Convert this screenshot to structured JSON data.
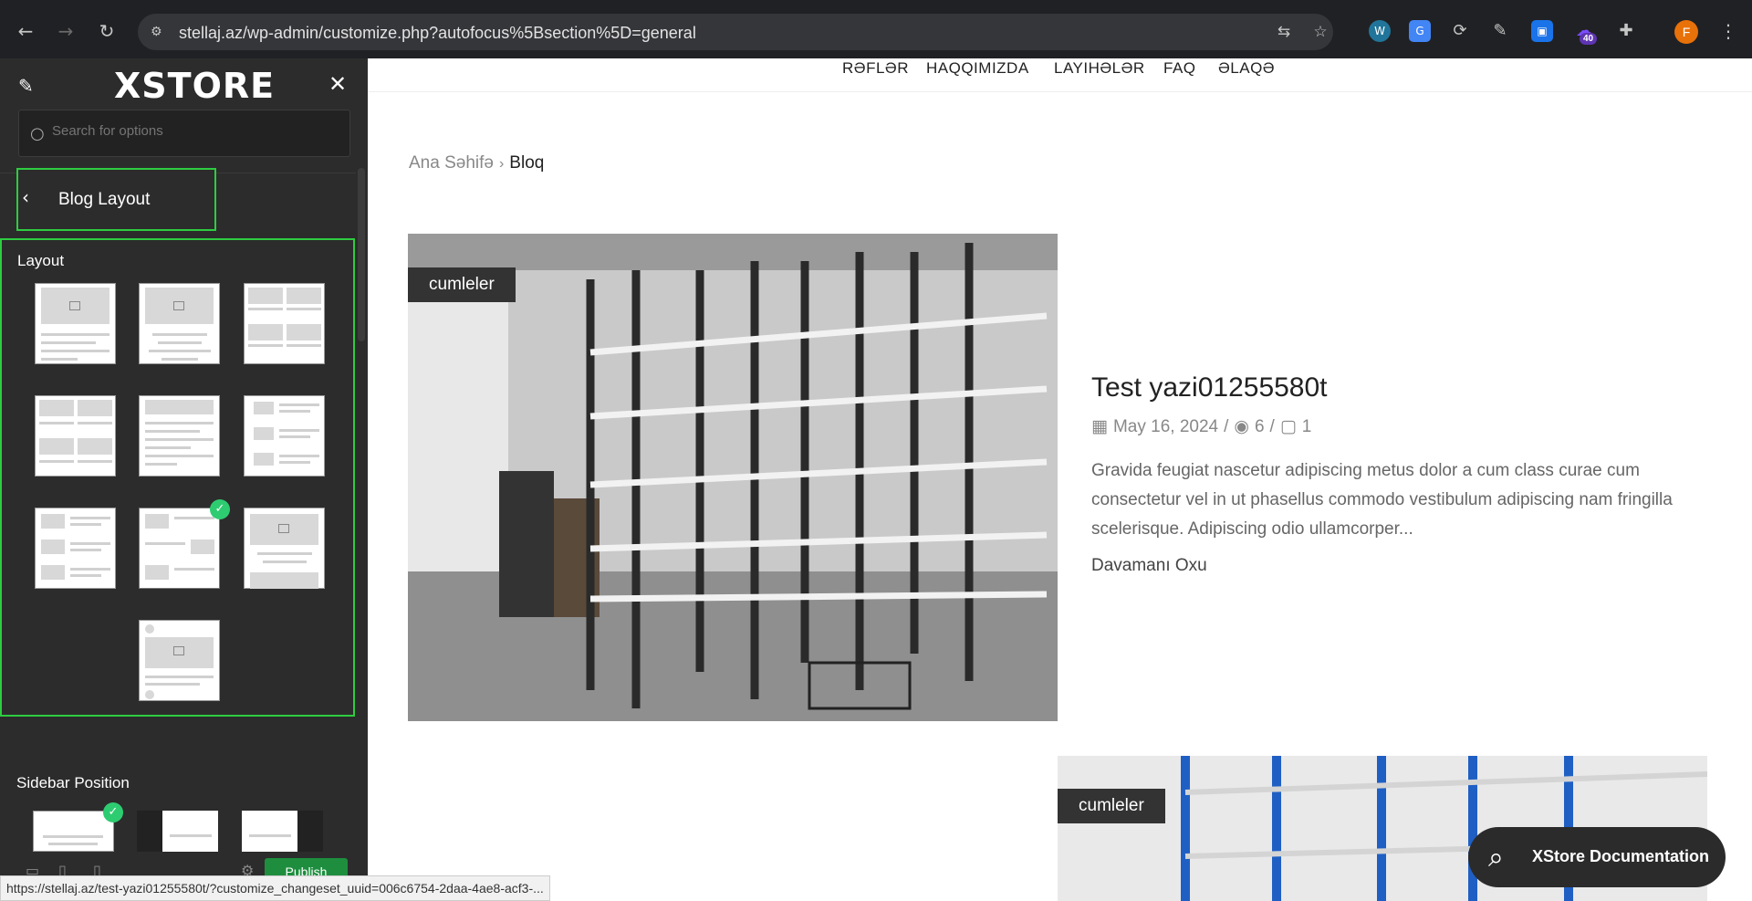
{
  "browser": {
    "url": "stellaj.az/wp-admin/customize.php?autofocus%5Bsection%5D=general",
    "extension_badge": "40",
    "profile_initial": "F",
    "status_url": "https://stellaj.az/test-yazi01255580t/?customize_changeset_uuid=006c6754-2daa-4ae8-acf3-..."
  },
  "sidebar": {
    "logo": "XSTORE",
    "search_placeholder": "Search for options",
    "section_title": "Blog Layout",
    "layout_label": "Layout",
    "sidebar_position_label": "Sidebar Position",
    "publish_label": "Publish",
    "selected_layout_index": 7,
    "selected_sidebar_index": 0
  },
  "preview": {
    "nav": [
      "RƏFLƏR",
      "HAQQIMIZDA",
      "LAYIHƏLƏR",
      "FAQ",
      "ƏLAQƏ"
    ],
    "breadcrumb_home": "Ana Səhifə",
    "breadcrumb_current": "Bloq",
    "posts": [
      {
        "category": "cumleler",
        "title": "Test yazi01255580t",
        "date": "May 16, 2024",
        "views": "6",
        "comments": "1",
        "excerpt": "Gravida feugiat nascetur adipiscing metus dolor a cum class curae cum consectetur vel in ut phasellus commodo vestibulum adipiscing nam fringilla scelerisque. Adipiscing odio ullamcorper...",
        "read_more": "Davamanı Oxu"
      },
      {
        "category": "cumleler"
      }
    ],
    "doc_button": "XStore Documentation"
  },
  "colors": {
    "accent_green": "#2ecc40",
    "panel_bg": "#2c2c2c",
    "publish_bg": "#1e8e3e"
  }
}
